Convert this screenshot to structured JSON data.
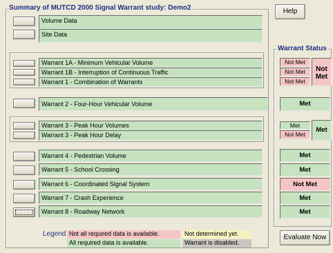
{
  "main_group": {
    "title": "Summary of MUTCD 2000 Signal Warrant study: Demo2"
  },
  "status_group": {
    "title": "Warrant Status"
  },
  "buttons": {
    "help": "Help",
    "evaluate": "Evaluate Now"
  },
  "rows": {
    "volume_data": "Volume Data",
    "site_data": "Site Data",
    "w1a": "Warrant 1A - Minimum Vehicular Volume",
    "w1b": "Warrant 1B - Interruption of Continuous Traffic",
    "w1": "Warrant 1 - Combination of Warrants",
    "w2": "Warrant 2 - Four-Hour Vehicular Volume",
    "w3a": "Warrant 3 - Peak Hour Volumes",
    "w3b": "Warrant 3 - Peak Hour Delay",
    "w4": "Warrant 4 - Pedestrian Volume",
    "w5": "Warrant 5 - School Crossing",
    "w6": "Warrant 6 - Coordinated Signal System",
    "w7": "Warrant 7 - Crash Experience",
    "w8": "Warrant 8 - Roadway Network"
  },
  "status": {
    "w1a": "Not Met",
    "w1b": "Not Met",
    "w1": "Not Met",
    "w1_overall_line1": "Not",
    "w1_overall_line2": "Met",
    "w2": "Met",
    "w3a": "Met",
    "w3b": "Not Met",
    "w3_overall": "Met",
    "w4": "Met",
    "w5": "Met",
    "w6": "Not Met",
    "w7": "Met",
    "w8": "Met"
  },
  "legend": {
    "title": "Legend",
    "not_all_data": "Not all required data is available.",
    "all_data": "All required data is available.",
    "not_determined": "Not determined yet.",
    "disabled": "Warrant is disabled."
  },
  "colors": {
    "green": "#c6e2bf",
    "pink": "#f5c4c4",
    "yellow": "#f8f1c2",
    "gray": "#c9c7c0",
    "title_blue": "#1f2f86"
  }
}
